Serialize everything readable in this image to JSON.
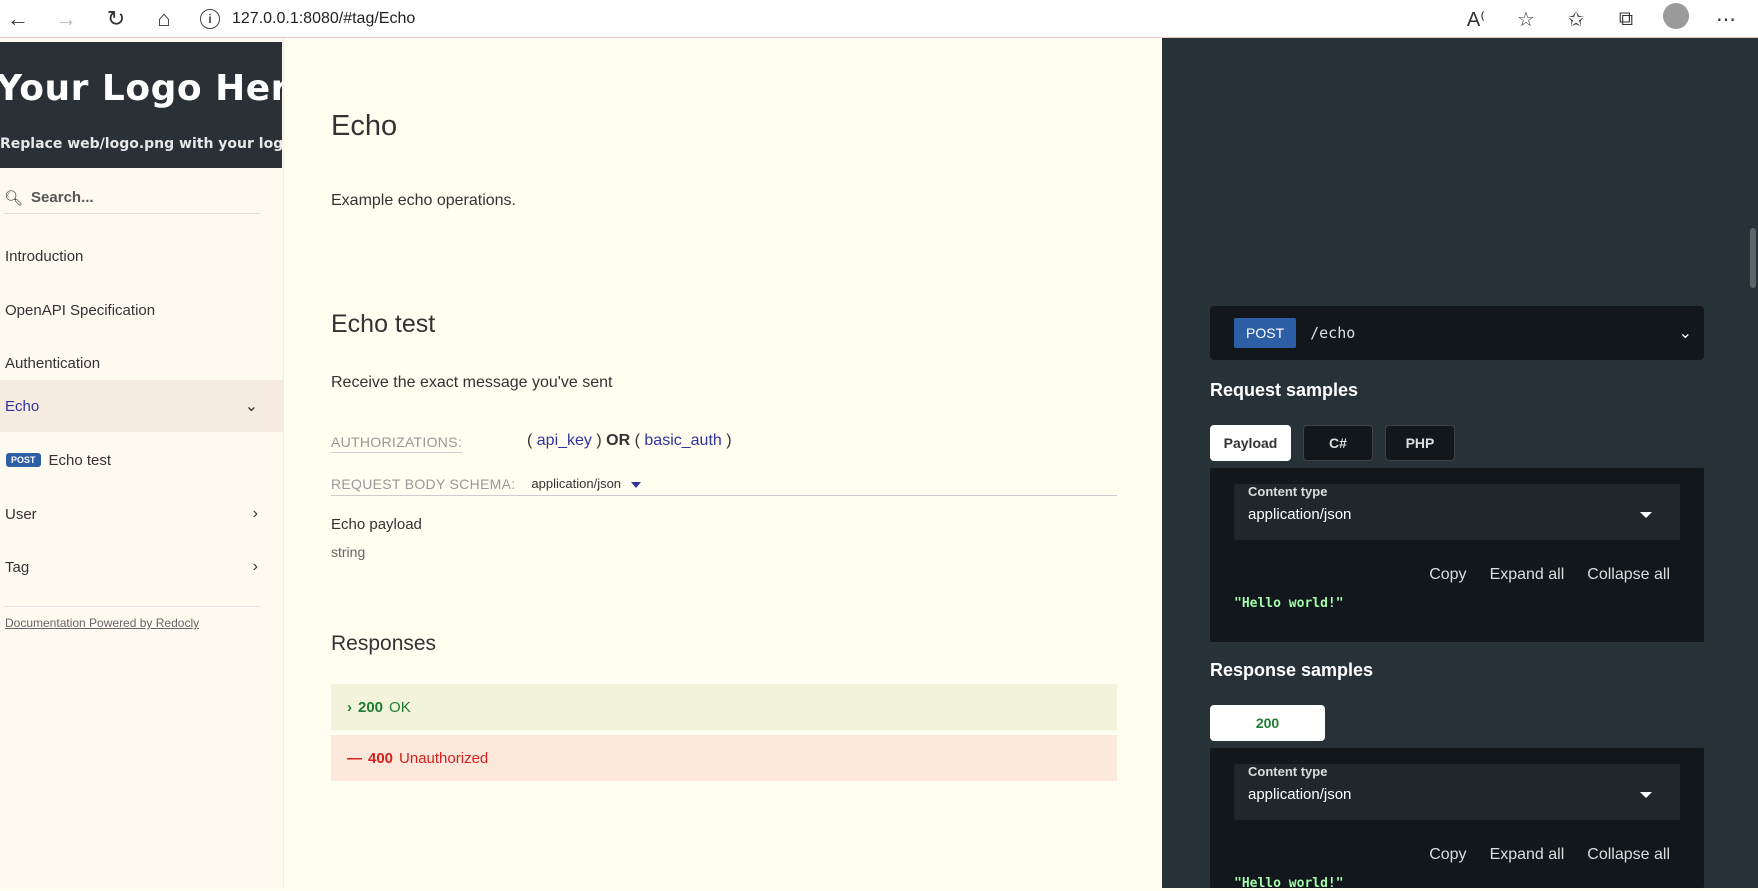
{
  "browser": {
    "url": "127.0.0.1:8080/#tag/Echo"
  },
  "sidebar": {
    "logo_title": "Your  Logo Here",
    "logo_subtitle": "Replace web/logo.png with your logo",
    "search_placeholder": "Search...",
    "items": [
      {
        "label": "Introduction"
      },
      {
        "label": "OpenAPI Specification"
      },
      {
        "label": "Authentication"
      },
      {
        "label": "Echo"
      },
      {
        "label": "User"
      },
      {
        "label": "Tag"
      }
    ],
    "sub_item": {
      "badge": "POST",
      "label": "Echo test"
    },
    "powered_by": "Documentation Powered by Redocly"
  },
  "main": {
    "title": "Echo",
    "description": "Example echo operations.",
    "operation_title": "Echo test",
    "operation_description": "Receive the exact message you've sent",
    "authorizations_label": "AUTHORIZATIONS:",
    "auth_open1": "(",
    "auth_key": "api_key",
    "auth_close1": ")",
    "auth_or": "OR",
    "auth_open2": "(",
    "auth_basic": "basic_auth",
    "auth_close2": ")",
    "request_body_label": "REQUEST BODY SCHEMA:",
    "request_body_type": "application/json",
    "payload_name": "Echo payload",
    "payload_type": "string",
    "responses_title": "Responses",
    "responses": [
      {
        "code": "200",
        "text": "OK",
        "prefix": "›"
      },
      {
        "code": "400",
        "text": "Unauthorized",
        "prefix": "—"
      }
    ]
  },
  "right_panel": {
    "method": "POST",
    "path": "/echo",
    "request_samples_title": "Request samples",
    "request_tabs": [
      "Payload",
      "C#",
      "PHP"
    ],
    "content_type_label": "Content type",
    "content_type_value": "application/json",
    "copy": "Copy",
    "expand_all": "Expand all",
    "collapse_all": "Collapse all",
    "request_code": "\"Hello world!\"",
    "response_samples_title": "Response samples",
    "response_tabs": [
      "200"
    ],
    "response_code": "\"Hello world!\""
  },
  "colors": {
    "accent": "#32329f",
    "post_badge": "#2d5fa6",
    "success": "#1e7d32",
    "error": "#d41f1c",
    "panel_bg": "#263238"
  }
}
